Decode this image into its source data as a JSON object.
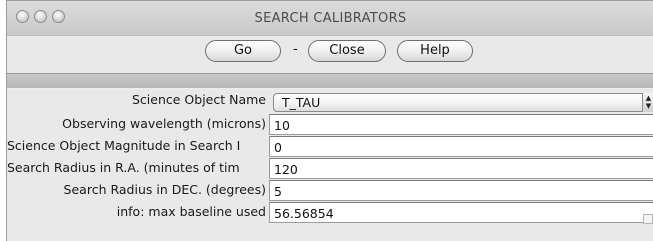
{
  "window": {
    "title": "SEARCH CALIBRATORS"
  },
  "toolbar": {
    "go_label": "Go",
    "separator": "-",
    "close_label": "Close",
    "help_label": "Help"
  },
  "form": {
    "science_object_name": {
      "label": "Science Object Name",
      "value": "T_TAU"
    },
    "observing_wavelength": {
      "label": "Observing wavelength (microns)",
      "value": "10"
    },
    "science_object_magnitude": {
      "label": "Science Object Magnitude in Search I",
      "value": "0"
    },
    "search_radius_ra": {
      "label": "Search Radius in R.A. (minutes of tim",
      "value": "120"
    },
    "search_radius_dec": {
      "label": "Search Radius in DEC. (degrees)",
      "value": "5"
    },
    "max_baseline": {
      "label": "info: max baseline used",
      "value": "56.56854"
    }
  }
}
